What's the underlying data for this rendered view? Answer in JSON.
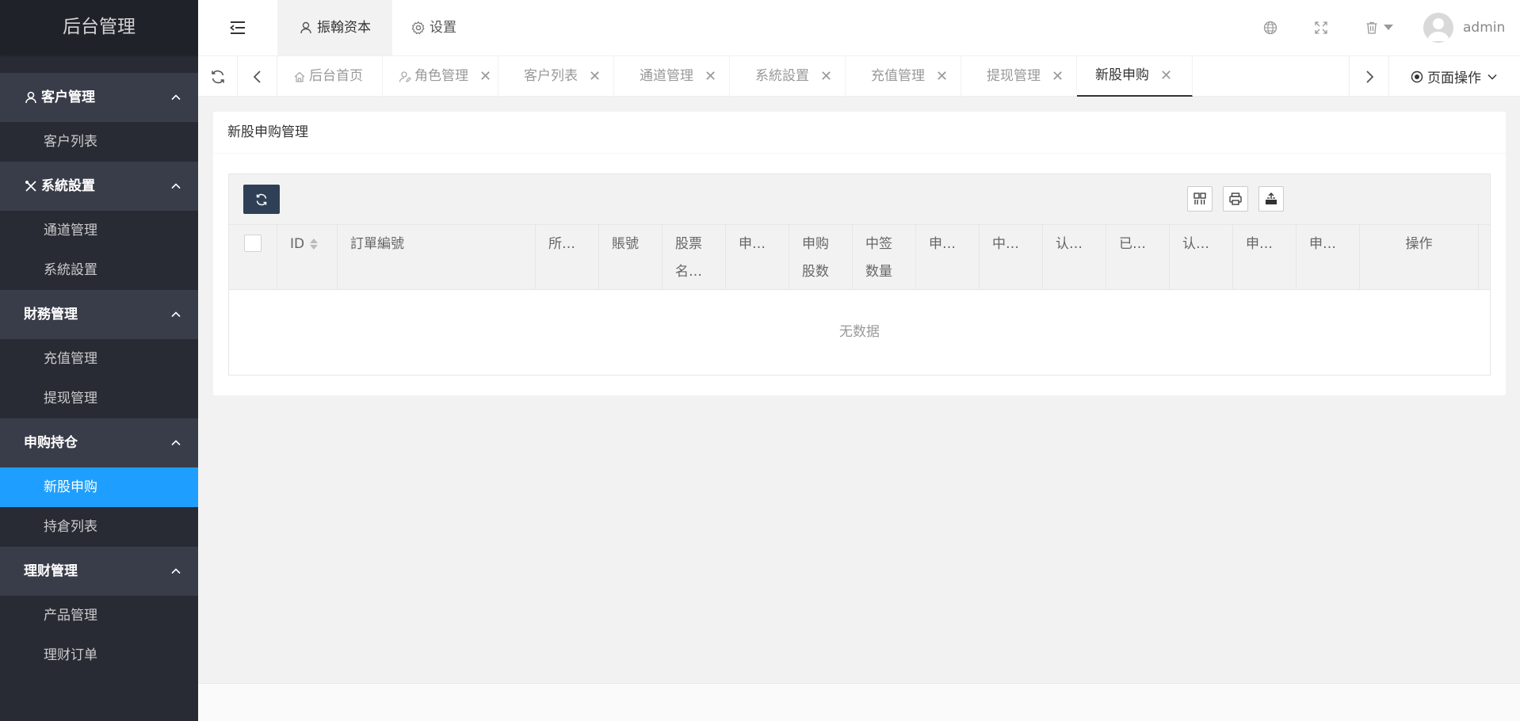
{
  "sidebar": {
    "logo": "后台管理",
    "groups": [
      {
        "title": "客户管理",
        "icon": "user-icon",
        "items": [
          "客户列表"
        ]
      },
      {
        "title": "系統設置",
        "icon": "tools-icon",
        "items": [
          "通道管理",
          "系統設置"
        ]
      },
      {
        "title": "財務管理",
        "icon": "",
        "items": [
          "充值管理",
          "提现管理"
        ]
      },
      {
        "title": "申购持仓",
        "icon": "",
        "items": [
          "新股申购",
          "持倉列表"
        ]
      },
      {
        "title": "理财管理",
        "icon": "",
        "items": [
          "产品管理",
          "理财订单"
        ]
      }
    ],
    "active_item": "新股申购",
    "colors": {
      "bg": "#282b33",
      "group_bg": "#393d49",
      "active": "#1e9fff"
    }
  },
  "header": {
    "nav": [
      {
        "label": "振翰资本",
        "icon": "user-icon",
        "active": true
      },
      {
        "label": "设置",
        "icon": "gear-icon",
        "active": false
      }
    ],
    "username": "admin"
  },
  "tabs": {
    "items": [
      {
        "label": "后台首页",
        "icon": "home-icon",
        "closable": false
      },
      {
        "label": "角色管理",
        "icon": "user-edit-icon",
        "closable": true
      },
      {
        "label": "客户列表",
        "closable": true
      },
      {
        "label": "通道管理",
        "closable": true
      },
      {
        "label": "系統設置",
        "closable": true
      },
      {
        "label": "充值管理",
        "closable": true
      },
      {
        "label": "提现管理",
        "closable": true
      },
      {
        "label": "新股申购",
        "closable": true,
        "active": true
      }
    ],
    "close_glyph": "✕",
    "page_ops": "页面操作"
  },
  "content": {
    "title": "新股申购管理",
    "table": {
      "columns": [
        {
          "label": "ID",
          "sortable": true
        },
        {
          "label": "訂單編號"
        },
        {
          "label": "所…"
        },
        {
          "label": "賬號"
        },
        {
          "label": "股票",
          "label2": "名…"
        },
        {
          "label": "申…"
        },
        {
          "label": "申购",
          "label2": "股数"
        },
        {
          "label": "中签",
          "label2": "数量"
        },
        {
          "label": "申…"
        },
        {
          "label": "中…"
        },
        {
          "label": "认…"
        },
        {
          "label": "已…"
        },
        {
          "label": "认…"
        },
        {
          "label": "申…"
        },
        {
          "label": "申…"
        },
        {
          "label": "操作"
        }
      ],
      "empty_text": "无数据"
    }
  }
}
